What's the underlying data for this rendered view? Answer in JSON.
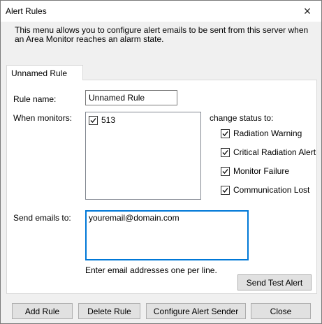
{
  "window": {
    "title": "Alert Rules",
    "close_icon": "×"
  },
  "intro_text": "This menu allows you to configure alert emails to be sent from this server when an Area Monitor reaches an alarm state.",
  "tab": {
    "label": "Unnamed Rule"
  },
  "rule": {
    "name_label": "Rule name:",
    "name_value": "Unnamed Rule",
    "monitors_label": "When monitors:",
    "monitors": [
      {
        "label": "513",
        "checked": true
      }
    ],
    "change_status_label": "change status to:",
    "statuses": [
      {
        "label": "Radiation Warning",
        "checked": true
      },
      {
        "label": "Critical Radiation Alert",
        "checked": true
      },
      {
        "label": "Monitor Failure",
        "checked": true
      },
      {
        "label": "Communication Lost",
        "checked": true
      }
    ],
    "emails_label": "Send emails to:",
    "emails_value": "youremail@domain.com",
    "emails_hint": "Enter email addresses one per line.",
    "send_test_label": "Send Test Alert"
  },
  "buttons": {
    "add_rule": "Add Rule",
    "delete_rule": "Delete Rule",
    "configure_sender": "Configure Alert Sender",
    "close": "Close"
  }
}
